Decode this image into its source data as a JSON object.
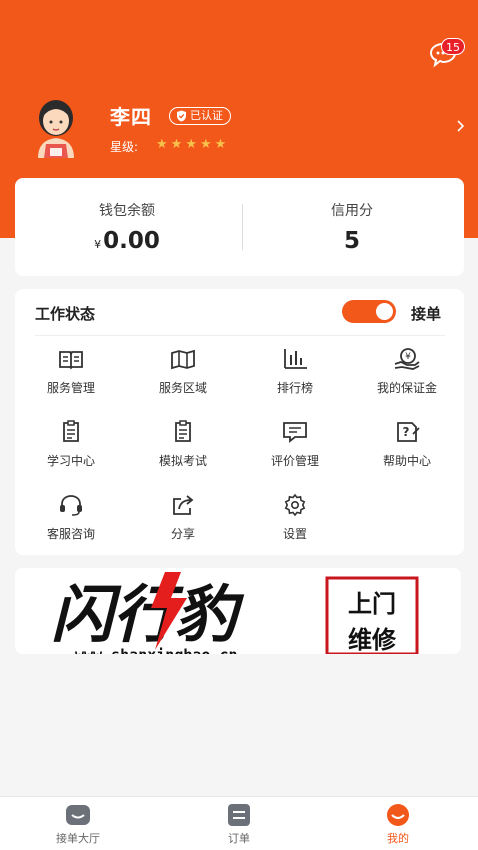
{
  "header": {
    "message_count": "15",
    "user_name": "李四",
    "verified_label": "已认证",
    "star_label": "星级:",
    "star_rating": 5,
    "accent_color": "#f3581b"
  },
  "wallet": {
    "balance_label": "钱包余额",
    "balance_currency": "¥",
    "balance_value": "0.00",
    "credit_label": "信用分",
    "credit_value": "5"
  },
  "work": {
    "status_label": "工作状态",
    "toggle_on": true,
    "toggle_label": "接单"
  },
  "menu": [
    {
      "label": "服务管理",
      "icon": "book-icon"
    },
    {
      "label": "服务区域",
      "icon": "map-icon"
    },
    {
      "label": "排行榜",
      "icon": "bar-chart-icon"
    },
    {
      "label": "我的保证金",
      "icon": "deposit-icon"
    },
    {
      "label": "学习中心",
      "icon": "study-icon"
    },
    {
      "label": "模拟考试",
      "icon": "exam-icon"
    },
    {
      "label": "评价管理",
      "icon": "comment-icon"
    },
    {
      "label": "帮助中心",
      "icon": "help-icon"
    },
    {
      "label": "客服咨询",
      "icon": "headset-icon"
    },
    {
      "label": "分享",
      "icon": "share-icon"
    },
    {
      "label": "设置",
      "icon": "gear-icon"
    }
  ],
  "banner": {
    "brand_text": "闪行豹",
    "side_text_1": "上门",
    "side_text_2": "维修",
    "url_text": "www.shanxingbao.cn"
  },
  "tabbar": [
    {
      "label": "接单大厅",
      "icon": "hall-icon",
      "active": false
    },
    {
      "label": "订单",
      "icon": "order-icon",
      "active": false
    },
    {
      "label": "我的",
      "icon": "profile-icon",
      "active": true
    }
  ]
}
